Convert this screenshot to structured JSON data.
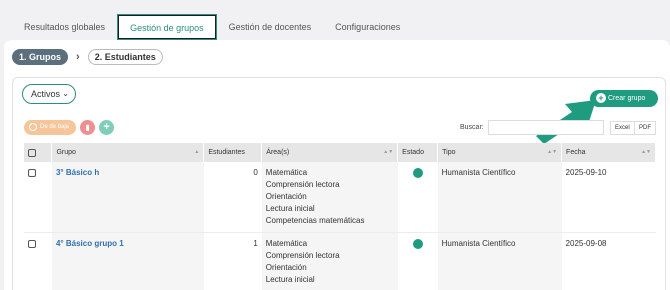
{
  "tabs": [
    {
      "label": "Resultados globales"
    },
    {
      "label": "Gestión de grupos"
    },
    {
      "label": "Gestión de docentes"
    },
    {
      "label": "Configuraciones"
    }
  ],
  "active_tab": 1,
  "steps": {
    "step1": "1. Grupos",
    "separator": "›",
    "step2": "2. Estudiantes"
  },
  "filter": {
    "selected": "Activos",
    "chevron_icon": "chevron-down-icon"
  },
  "create_button": {
    "label": "Crear grupo",
    "icon": "plus-icon"
  },
  "toolbar": {
    "deactivate_label": "De de baja",
    "delete_icon": "trash-icon",
    "add_icon": "plus-icon"
  },
  "search": {
    "label": "Buscar:",
    "value": ""
  },
  "export": {
    "excel": "Excel",
    "pdf": "PDF"
  },
  "table": {
    "headers": [
      "",
      "Grupo",
      "Estudiantes",
      "Área(s)",
      "Estado",
      "Tipo",
      "Fecha"
    ],
    "rows": [
      {
        "grupo": "3° Básico h",
        "estudiantes": "0",
        "areas": [
          "Matemática",
          "Comprensión lectora",
          "Orientación",
          "Lectura inicial",
          "Competencias matemáticas"
        ],
        "estado": "active",
        "tipo": "Humanista Científico",
        "fecha": "2025-09-10"
      },
      {
        "grupo": "4° Básico grupo 1",
        "estudiantes": "1",
        "areas": [
          "Matemática",
          "Comprensión lectora",
          "Orientación",
          "Lectura inicial"
        ],
        "estado": "active",
        "tipo": "Humanista Científico",
        "fecha": "2025-09-08"
      }
    ]
  },
  "colors": {
    "accent": "#1f9b80",
    "link": "#2f6fb0",
    "step_active": "#5c6f7d"
  }
}
